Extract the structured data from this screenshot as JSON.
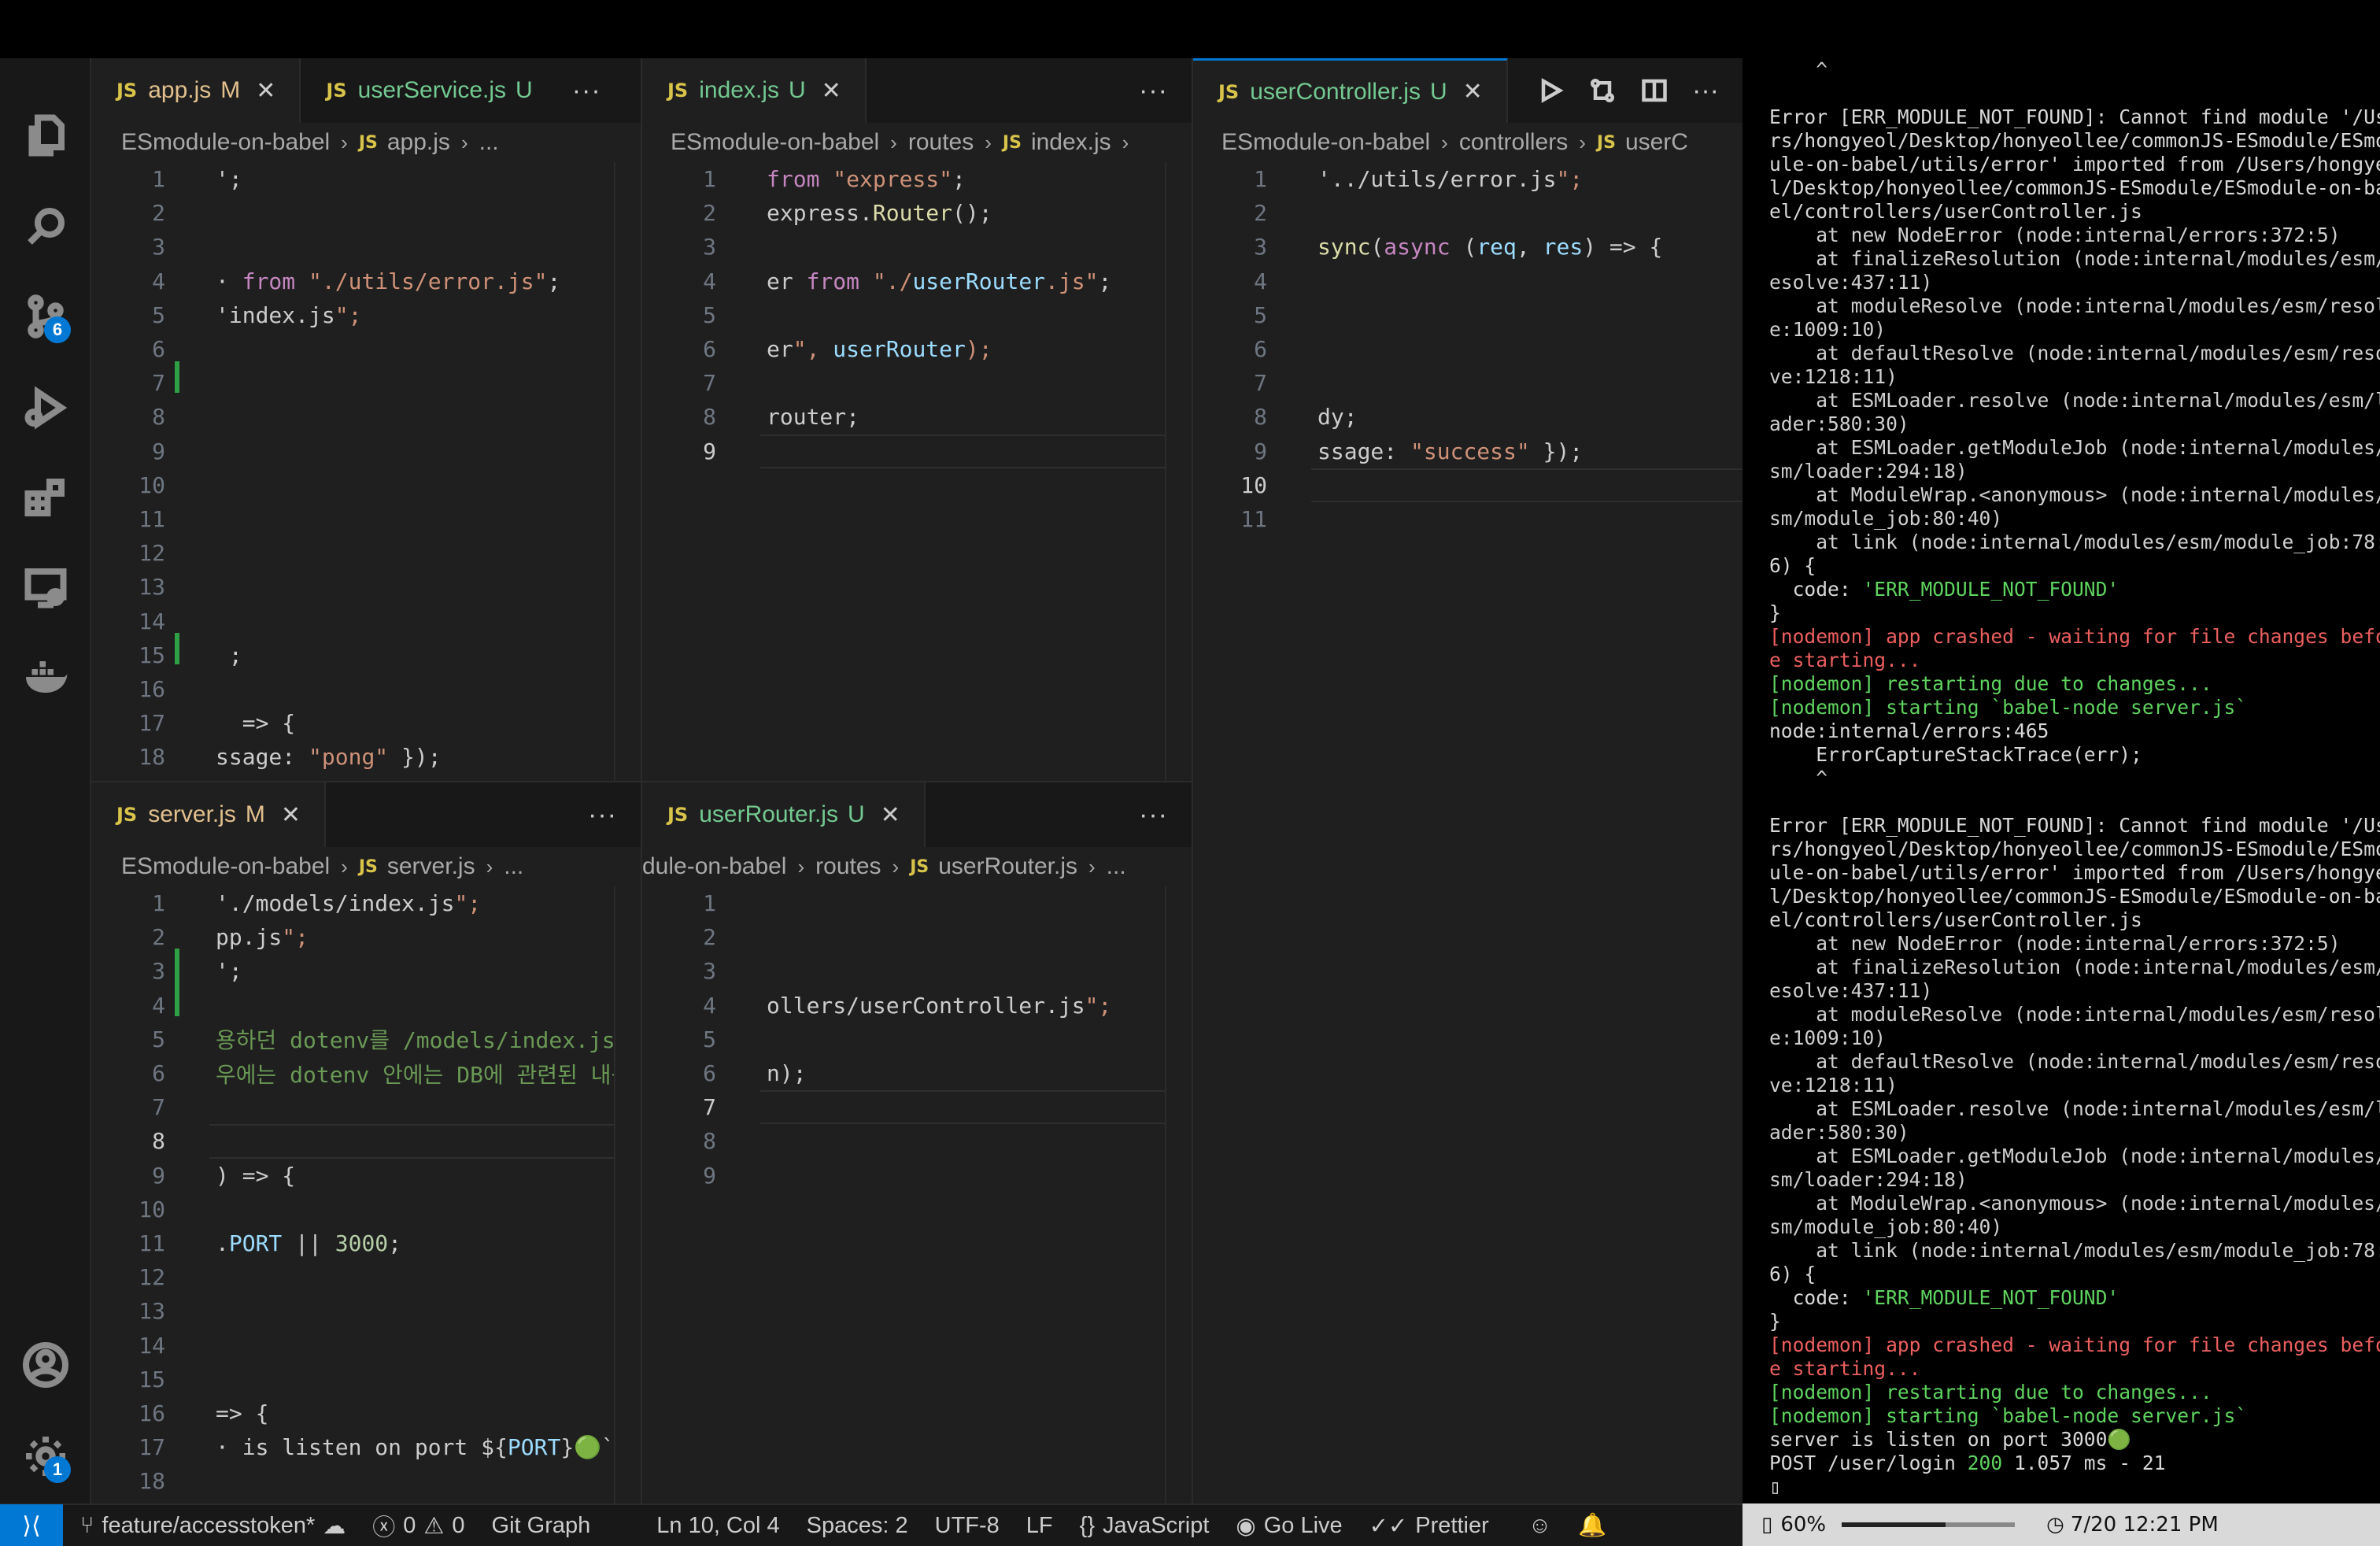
{
  "activity_bar": {
    "scm_badge": "6",
    "settings_badge": "1"
  },
  "panes": {
    "app": {
      "tabs": [
        {
          "label": "app.js",
          "status": "M"
        },
        {
          "label": "userService.js",
          "status": "U"
        }
      ],
      "breadcrumb": [
        "ESmodule-on-babel",
        "app.js",
        "..."
      ],
      "lines": [
        {
          "n": "1",
          "t": "';"
        },
        {
          "n": "2",
          "t": ""
        },
        {
          "n": "3",
          "t": ""
        },
        {
          "n": "4",
          "t": "· from \"./utils/error.js\";"
        },
        {
          "n": "5",
          "t": "'index.js\";"
        },
        {
          "n": "6",
          "t": ""
        },
        {
          "n": "7",
          "t": ""
        },
        {
          "n": "8",
          "t": ""
        },
        {
          "n": "9",
          "t": ""
        },
        {
          "n": "10",
          "t": ""
        },
        {
          "n": "11",
          "t": ""
        },
        {
          "n": "12",
          "t": ""
        },
        {
          "n": "13",
          "t": ""
        },
        {
          "n": "14",
          "t": ""
        },
        {
          "n": "15",
          "t": " ;"
        },
        {
          "n": "16",
          "t": ""
        },
        {
          "n": "17",
          "t": "  => {"
        },
        {
          "n": "18",
          "t": "ssage: \"pong\" });"
        }
      ]
    },
    "index": {
      "tabs": [
        {
          "label": "index.js",
          "status": "U"
        }
      ],
      "breadcrumb": [
        "ESmodule-on-babel",
        "routes",
        "index.js",
        ""
      ],
      "lines": [
        {
          "n": "1",
          "t": "from \"express\";"
        },
        {
          "n": "2",
          "t": "express.Router();"
        },
        {
          "n": "3",
          "t": ""
        },
        {
          "n": "4",
          "t": "er from \"./userRouter.js\";"
        },
        {
          "n": "5",
          "t": ""
        },
        {
          "n": "6",
          "t": "er\", userRouter);"
        },
        {
          "n": "7",
          "t": ""
        },
        {
          "n": "8",
          "t": "router;"
        },
        {
          "n": "9",
          "t": ""
        }
      ]
    },
    "controller": {
      "tabs": [
        {
          "label": "userController.js",
          "status": "U"
        }
      ],
      "breadcrumb": [
        "ESmodule-on-babel",
        "controllers",
        "userC"
      ],
      "lines": [
        {
          "n": "1",
          "t": "'../utils/error.js\";"
        },
        {
          "n": "2",
          "t": ""
        },
        {
          "n": "3",
          "t": "sync(async (req, res) => {"
        },
        {
          "n": "4",
          "t": ""
        },
        {
          "n": "5",
          "t": ""
        },
        {
          "n": "6",
          "t": ""
        },
        {
          "n": "7",
          "t": ""
        },
        {
          "n": "8",
          "t": "dy;"
        },
        {
          "n": "9",
          "t": "ssage: \"success\" });"
        },
        {
          "n": "10",
          "t": ""
        },
        {
          "n": "11",
          "t": ""
        }
      ]
    },
    "server": {
      "tabs": [
        {
          "label": "server.js",
          "status": "M"
        }
      ],
      "breadcrumb": [
        "ESmodule-on-babel",
        "server.js",
        "..."
      ],
      "lines": [
        {
          "n": "1",
          "t": "'./models/index.js\";"
        },
        {
          "n": "2",
          "t": "pp.js\";"
        },
        {
          "n": "3",
          "t": "';"
        },
        {
          "n": "4",
          "t": ""
        },
        {
          "n": "5",
          "t": "용하던 dotenv를 /models/index.js로"
        },
        {
          "n": "6",
          "t": "우에는 dotenv 안에는 DB에 관련된 내용만"
        },
        {
          "n": "7",
          "t": ""
        },
        {
          "n": "8",
          "t": ""
        },
        {
          "n": "9",
          "t": ") => {"
        },
        {
          "n": "10",
          "t": ""
        },
        {
          "n": "11",
          "t": ".PORT || 3000;"
        },
        {
          "n": "12",
          "t": ""
        },
        {
          "n": "13",
          "t": ""
        },
        {
          "n": "14",
          "t": ""
        },
        {
          "n": "15",
          "t": ""
        },
        {
          "n": "16",
          "t": "=> {"
        },
        {
          "n": "17",
          "t": "· is listen on port ${PORT}🟢`);"
        },
        {
          "n": "18",
          "t": ""
        }
      ]
    },
    "router": {
      "tabs": [
        {
          "label": "userRouter.js",
          "status": "U"
        }
      ],
      "breadcrumb": [
        "dule-on-babel",
        "routes",
        "userRouter.js",
        "..."
      ],
      "lines": [
        {
          "n": "1",
          "t": ""
        },
        {
          "n": "2",
          "t": ""
        },
        {
          "n": "3",
          "t": ""
        },
        {
          "n": "4",
          "t": "ollers/userController.js\";"
        },
        {
          "n": "5",
          "t": ""
        },
        {
          "n": "6",
          "t": "n);"
        },
        {
          "n": "7",
          "t": ""
        },
        {
          "n": "8",
          "t": ""
        },
        {
          "n": "9",
          "t": ""
        }
      ]
    }
  },
  "terminal": {
    "lines": [
      {
        "t": "    ^",
        "c": "t-gray"
      },
      {
        "t": "",
        "c": ""
      },
      {
        "t": "Error [ERR_MODULE_NOT_FOUND]: Cannot find module '/Use",
        "c": ""
      },
      {
        "t": "rs/hongyeol/Desktop/honyeollee/commonJS-ESmodule/ESmod",
        "c": ""
      },
      {
        "t": "ule-on-babel/utils/error' imported from /Users/hongyeo",
        "c": ""
      },
      {
        "t": "l/Desktop/honyeollee/commonJS-ESmodule/ESmodule-on-bab",
        "c": ""
      },
      {
        "t": "el/controllers/userController.js",
        "c": ""
      },
      {
        "t": "    at new NodeError (node:internal/errors:372:5)",
        "c": "t-gray"
      },
      {
        "t": "    at finalizeResolution (node:internal/modules/esm/r",
        "c": "t-gray"
      },
      {
        "t": "esolve:437:11)",
        "c": "t-gray"
      },
      {
        "t": "    at moduleResolve (node:internal/modules/esm/resolv",
        "c": "t-gray"
      },
      {
        "t": "e:1009:10)",
        "c": "t-gray"
      },
      {
        "t": "    at defaultResolve (node:internal/modules/esm/resol",
        "c": "t-gray"
      },
      {
        "t": "ve:1218:11)",
        "c": "t-gray"
      },
      {
        "t": "    at ESMLoader.resolve (node:internal/modules/esm/lo",
        "c": "t-gray"
      },
      {
        "t": "ader:580:30)",
        "c": "t-gray"
      },
      {
        "t": "    at ESMLoader.getModuleJob (node:internal/modules/e",
        "c": "t-gray"
      },
      {
        "t": "sm/loader:294:18)",
        "c": "t-gray"
      },
      {
        "t": "    at ModuleWrap.<anonymous> (node:internal/modules/e",
        "c": "t-gray"
      },
      {
        "t": "sm/module_job:80:40)",
        "c": "t-gray"
      },
      {
        "t": "    at link (node:internal/modules/esm/module_job:78:3",
        "c": "t-gray"
      },
      {
        "t": "6) {",
        "c": ""
      },
      {
        "t": "  code: 'ERR_MODULE_NOT_FOUND'",
        "c": "code"
      },
      {
        "t": "}",
        "c": ""
      },
      {
        "t": "[nodemon] app crashed - waiting for file changes befor",
        "c": "t-red"
      },
      {
        "t": "e starting...",
        "c": "t-red"
      },
      {
        "t": "[nodemon] restarting due to changes...",
        "c": "t-green"
      },
      {
        "t": "[nodemon] starting `babel-node server.js`",
        "c": "t-green"
      },
      {
        "t": "node:internal/errors:465",
        "c": ""
      },
      {
        "t": "    ErrorCaptureStackTrace(err);",
        "c": ""
      },
      {
        "t": "    ^",
        "c": "t-gray"
      },
      {
        "t": "",
        "c": ""
      },
      {
        "t": "Error [ERR_MODULE_NOT_FOUND]: Cannot find module '/Use",
        "c": ""
      },
      {
        "t": "rs/hongyeol/Desktop/honyeollee/commonJS-ESmodule/ESmod",
        "c": ""
      },
      {
        "t": "ule-on-babel/utils/error' imported from /Users/hongyeo",
        "c": ""
      },
      {
        "t": "l/Desktop/honyeollee/commonJS-ESmodule/ESmodule-on-bab",
        "c": ""
      },
      {
        "t": "el/controllers/userController.js",
        "c": ""
      },
      {
        "t": "    at new NodeError (node:internal/errors:372:5)",
        "c": "t-gray"
      },
      {
        "t": "    at finalizeResolution (node:internal/modules/esm/r",
        "c": "t-gray"
      },
      {
        "t": "esolve:437:11)",
        "c": "t-gray"
      },
      {
        "t": "    at moduleResolve (node:internal/modules/esm/resolv",
        "c": "t-gray"
      },
      {
        "t": "e:1009:10)",
        "c": "t-gray"
      },
      {
        "t": "    at defaultResolve (node:internal/modules/esm/resol",
        "c": "t-gray"
      },
      {
        "t": "ve:1218:11)",
        "c": "t-gray"
      },
      {
        "t": "    at ESMLoader.resolve (node:internal/modules/esm/lo",
        "c": "t-gray"
      },
      {
        "t": "ader:580:30)",
        "c": "t-gray"
      },
      {
        "t": "    at ESMLoader.getModuleJob (node:internal/modules/e",
        "c": "t-gray"
      },
      {
        "t": "sm/loader:294:18)",
        "c": "t-gray"
      },
      {
        "t": "    at ModuleWrap.<anonymous> (node:internal/modules/e",
        "c": "t-gray"
      },
      {
        "t": "sm/module_job:80:40)",
        "c": "t-gray"
      },
      {
        "t": "    at link (node:internal/modules/esm/module_job:78:3",
        "c": "t-gray"
      },
      {
        "t": "6) {",
        "c": ""
      },
      {
        "t": "  code: 'ERR_MODULE_NOT_FOUND'",
        "c": "code"
      },
      {
        "t": "}",
        "c": ""
      },
      {
        "t": "[nodemon] app crashed - waiting for file changes befor",
        "c": "t-red"
      },
      {
        "t": "e starting...",
        "c": "t-red"
      },
      {
        "t": "[nodemon] restarting due to changes...",
        "c": "t-green"
      },
      {
        "t": "[nodemon] starting `babel-node server.js`",
        "c": "t-green"
      },
      {
        "t": "server is listen on port 3000🟢",
        "c": ""
      },
      {
        "t": "POST /user/login 200 1.057 ms - 21",
        "c": "post"
      },
      {
        "t": "▯",
        "c": ""
      }
    ]
  },
  "status_bar": {
    "branch": "feature/accesstoken*",
    "errors": "0",
    "warnings": "0",
    "git_graph": "Git Graph",
    "position": "Ln 10, Col 4",
    "spaces": "Spaces: 2",
    "encoding": "UTF-8",
    "eol": "LF",
    "language": "JavaScript",
    "go_live": "Go Live",
    "prettier": "Prettier"
  },
  "terminal_status": {
    "battery": "60%",
    "battery_level": 0.6,
    "datetime": "7/20 12:21 PM"
  },
  "colors": {
    "accent": "#0078d4",
    "git_added": "#2ea043",
    "js_icon": "#d8c44a"
  }
}
